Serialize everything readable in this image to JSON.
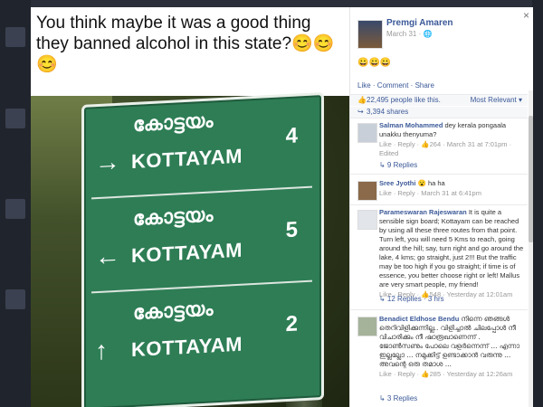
{
  "photo": {
    "caption": "You think maybe it was a good thing they banned alcohol in this state?😊😊😊",
    "sign": {
      "panels": [
        {
          "malayalam": "കോട്ടയം",
          "english": "KOTTAYAM",
          "number": "4",
          "arrow": "→"
        },
        {
          "malayalam": "കോട്ടയം",
          "english": "KOTTAYAM",
          "number": "5",
          "arrow": "←"
        },
        {
          "malayalam": "കോട്ടയം",
          "english": "KOTTAYAM",
          "number": "2",
          "arrow": "↑"
        }
      ]
    }
  },
  "post": {
    "close_icon": "×",
    "author": "Premgi Amaren",
    "date": "March 31 · 🌐",
    "text": "😀😀😀",
    "actions": "Like · Comment · Share",
    "likes": "22,495 people like this.",
    "relevance": "Most Relevant ▾",
    "shares": "3,394 shares"
  },
  "comments": [
    {
      "name": "Salman Mohammed",
      "text": "dey kerala pongaala unakku thenyuma?",
      "meta": "Like · Reply · 👍264 · March 31 at 7:01pm · Edited",
      "replies": "↳ 9 Replies"
    },
    {
      "name": "Sree Jyothi",
      "text": "😮 ha ha",
      "meta": "Like · Reply · March 31 at 6:41pm",
      "replies": ""
    },
    {
      "name": "Parameswaran Rajeswaran",
      "text": "It is quite a sensible sign board; Kottayam can be reached by using all these three routes from that point. Turn left, you will need 5 Kms to reach, going around the hill; say, turn right and go around the lake, 4 kms; go straight, just 2!!! But the traffic may be too high if you go straight; if time is of essence, you better choose right or left! Mallus are very smart people, my friend!",
      "meta": "Like · Reply · 👍548 · Yesterday at 12:01am",
      "replies": "↳ 12 Replies · 3 hrs"
    },
    {
      "name": "Benadict Eldhose Bendu",
      "text": "നിന്നെ ഞങ്ങൾ തെറിവിളിക്കുന്നില്ല.. വിളിച്ചാൽ ചിലപ്പോൾ നീ വിചാരിക്കും നീ ഷാരൂഖാണെന്ന് . ജോൺസണും പോലെ വളർന്നെന്ന് ... എന്നാ ഇല്ലല്ലോ ... നമുക്കിട്ട് ഉണ്ടാക്കാൻ വരുന്നു ... അവന്റെ ഒരു തമാശ ...",
      "meta": "Like · Reply · 👍285 · Yesterday at 12:26am",
      "replies": "↳ 3 Replies"
    }
  ],
  "colors": {
    "fb_link": "#3b5998",
    "sign_green": "#2e7d55"
  }
}
